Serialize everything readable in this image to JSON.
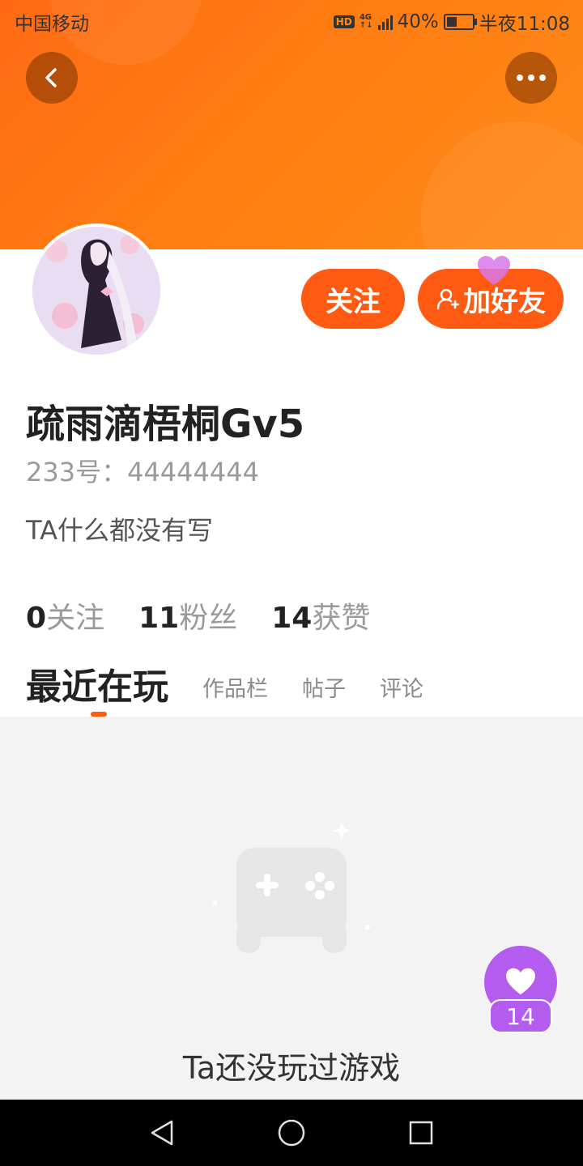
{
  "status_bar": {
    "carrier": "中国移动",
    "network": "4G",
    "battery": "40%",
    "time": "半夜11:08"
  },
  "profile": {
    "name": "疏雨滴梧桐Gv5",
    "id_line": "233号：44444444",
    "bio": "TA什么都没有写"
  },
  "actions": {
    "follow_label": "关注",
    "add_friend_label": "加好友"
  },
  "stats": [
    {
      "num": "0",
      "label": "关注"
    },
    {
      "num": "11",
      "label": "粉丝"
    },
    {
      "num": "14",
      "label": "获赞"
    }
  ],
  "tabs": [
    {
      "label": "最近在玩",
      "active": true
    },
    {
      "label": "作品栏",
      "active": false
    },
    {
      "label": "帖子",
      "active": false
    },
    {
      "label": "评论",
      "active": false
    }
  ],
  "empty_state": {
    "message": "Ta还没玩过游戏"
  },
  "likes_badge": {
    "count": "14"
  },
  "colors": {
    "accent": "#ff5a12",
    "header": "#ff7d12",
    "likes": "#b45cf0"
  }
}
